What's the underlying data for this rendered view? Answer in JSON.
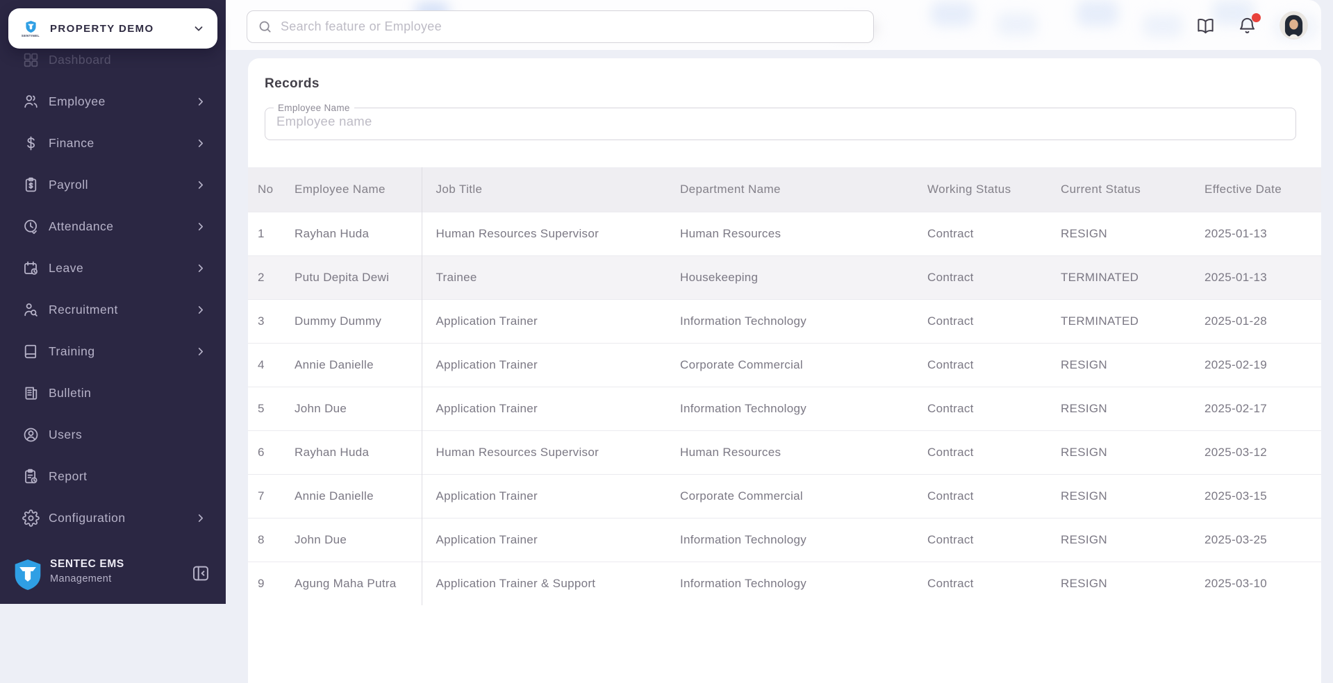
{
  "sidebar": {
    "workspace": {
      "name": "PROPERTY DEMO",
      "logo": "sentinel-shield-logo",
      "logo_text": "SENTINEL"
    },
    "items": [
      {
        "label": "Dashboard",
        "icon": "dashboard-icon",
        "expandable": false,
        "faded": true
      },
      {
        "label": "Employee",
        "icon": "employee-icon",
        "expandable": true
      },
      {
        "label": "Finance",
        "icon": "finance-icon",
        "expandable": true
      },
      {
        "label": "Payroll",
        "icon": "payroll-icon",
        "expandable": true
      },
      {
        "label": "Attendance",
        "icon": "attendance-icon",
        "expandable": true
      },
      {
        "label": "Leave",
        "icon": "leave-icon",
        "expandable": true
      },
      {
        "label": "Recruitment",
        "icon": "recruitment-icon",
        "expandable": true
      },
      {
        "label": "Training",
        "icon": "training-icon",
        "expandable": true
      },
      {
        "label": "Bulletin",
        "icon": "bulletin-icon",
        "expandable": false
      },
      {
        "label": "Users",
        "icon": "users-icon",
        "expandable": false
      },
      {
        "label": "Report",
        "icon": "report-icon",
        "expandable": false
      },
      {
        "label": "Configuration",
        "icon": "configuration-icon",
        "expandable": true
      }
    ],
    "footer": {
      "title": "SENTEC EMS",
      "subtitle": "Management"
    }
  },
  "header": {
    "search": {
      "placeholder": "Search feature or Employee"
    },
    "notification_badge": true
  },
  "main": {
    "title": "Records",
    "filter": {
      "label": "Employee Name",
      "placeholder": "Employee name"
    },
    "table": {
      "columns": [
        "No",
        "Employee Name",
        "Job Title",
        "Department Name",
        "Working Status",
        "Current Status",
        "Effective Date"
      ],
      "rows": [
        [
          "1",
          "Rayhan Huda",
          "Human Resources Supervisor",
          "Human Resources",
          "Contract",
          "RESIGN",
          "2025-01-13"
        ],
        [
          "2",
          "Putu Depita Dewi",
          "Trainee",
          "Housekeeping",
          "Contract",
          "TERMINATED",
          "2025-01-13"
        ],
        [
          "3",
          "Dummy Dummy",
          "Application Trainer",
          "Information Technology",
          "Contract",
          "TERMINATED",
          "2025-01-28"
        ],
        [
          "4",
          "Annie Danielle",
          "Application Trainer",
          "Corporate Commercial",
          "Contract",
          "RESIGN",
          "2025-02-19"
        ],
        [
          "5",
          "John Due",
          "Application Trainer",
          "Information Technology",
          "Contract",
          "RESIGN",
          "2025-02-17"
        ],
        [
          "6",
          "Rayhan Huda",
          "Human Resources Supervisor",
          "Human Resources",
          "Contract",
          "RESIGN",
          "2025-03-12"
        ],
        [
          "7",
          "Annie Danielle",
          "Application Trainer",
          "Corporate Commercial",
          "Contract",
          "RESIGN",
          "2025-03-15"
        ],
        [
          "8",
          "John Due",
          "Application Trainer",
          "Information Technology",
          "Contract",
          "RESIGN",
          "2025-03-25"
        ],
        [
          "9",
          "Agung Maha Putra",
          "Application Trainer & Support",
          "Information Technology",
          "Contract",
          "RESIGN",
          "2025-03-10"
        ]
      ],
      "highlighted_row_index": 1
    }
  },
  "colors": {
    "sidebar_bg": "#2b2743",
    "logo_blue": "#2f9fe4",
    "notification_red": "#e8423c",
    "row_highlight": "#f4f3f6"
  }
}
